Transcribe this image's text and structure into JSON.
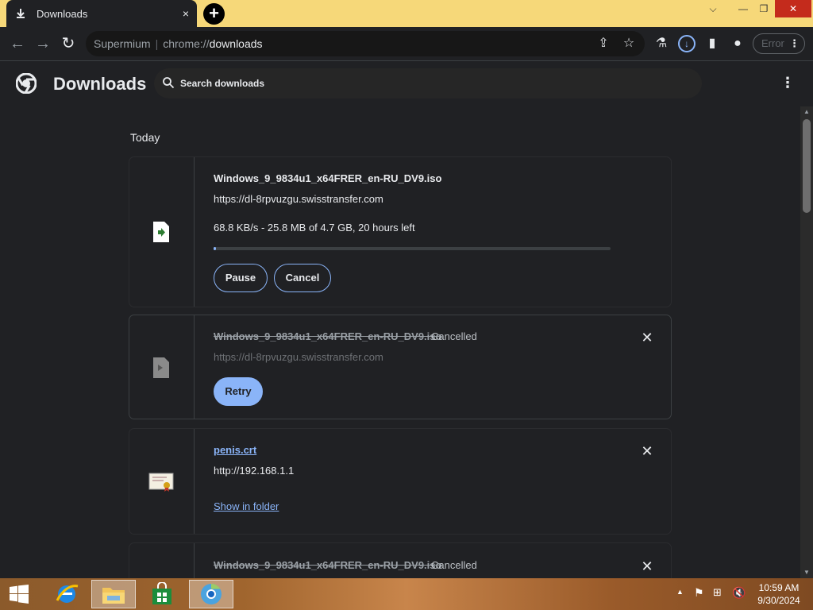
{
  "tab": {
    "title": "Downloads",
    "close": "×",
    "new_tab": "+"
  },
  "window_controls": {
    "minimize": "—",
    "restore": "❐",
    "close": "✕",
    "chevron": "⌵"
  },
  "toolbar": {
    "omnibox_origin": "Supermium",
    "omnibox_scheme": "chrome://",
    "omnibox_host": "downloads",
    "error_label": "Error"
  },
  "header": {
    "title": "Downloads",
    "search_placeholder": "Search downloads"
  },
  "section_label": "Today",
  "downloads": [
    {
      "filename": "Windows_9_9834u1_x64FRER_en-RU_DV9.iso",
      "url": "https://dl-8rpvuzgu.swisstransfer.com",
      "progress_text": "68.8 KB/s - 25.8 MB of 4.7 GB, 20 hours left",
      "progress_fraction": 0.005,
      "buttons": {
        "pause": "Pause",
        "cancel": "Cancel"
      }
    },
    {
      "filename": "Windows_9_9834u1_x64FRER_en-RU_DV9.iso",
      "status": "Cancelled",
      "url": "https://dl-8rpvuzgu.swisstransfer.com",
      "buttons": {
        "retry": "Retry"
      }
    },
    {
      "filename": "penis.crt",
      "url": "http://192.168.1.1",
      "buttons": {
        "show_in_folder": "Show in folder"
      }
    },
    {
      "filename": "Windows_9_9834u1_x64FRER_en-RU_DV9.iso",
      "status": "Cancelled"
    }
  ],
  "taskbar": {
    "clock_time": "10:59 AM",
    "clock_date": "9/30/2024"
  },
  "colors": {
    "accent": "#8ab4f8",
    "tabstrip": "#f6d879",
    "background": "#202124"
  }
}
